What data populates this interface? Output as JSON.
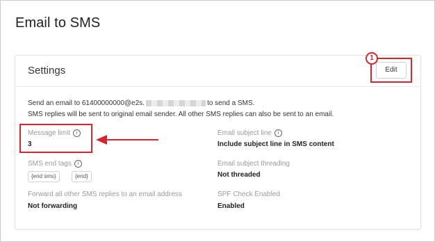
{
  "page": {
    "title": "Email to SMS"
  },
  "settings": {
    "title": "Settings",
    "edit_label": "Edit",
    "step_number": "1",
    "description": {
      "line1_prefix": "Send an email to 61400000000@e2s.",
      "line1_suffix": "to send a SMS.",
      "line2": "SMS replies will be sent to original email sender. All other SMS replies can also be sent to an email."
    },
    "fields": {
      "message_limit": {
        "label": "Message limit",
        "value": "3"
      },
      "sms_end_tags": {
        "label": "SMS end tags",
        "tags": [
          "{end sms}",
          "{end}"
        ]
      },
      "forward": {
        "label": "Forward all other SMS replies to an email address",
        "value": "Not forwarding"
      },
      "email_subject_line": {
        "label": "Email subject line",
        "value": "Include subject line in SMS content"
      },
      "email_subject_threading": {
        "label": "Email subject threading",
        "value": "Not threaded"
      },
      "spf_check": {
        "label": "SPF Check Enabled",
        "value": "Enabled"
      }
    }
  },
  "icons": {
    "info": "info-icon",
    "arrow": "left-arrow-icon"
  },
  "colors": {
    "highlight": "#d9242b"
  }
}
